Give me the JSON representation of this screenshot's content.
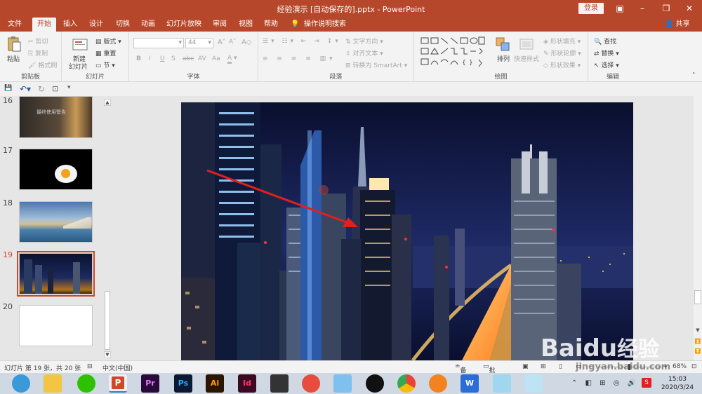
{
  "window": {
    "title": "经验演示 [自动保存的].pptx - PowerPoint",
    "login": "登录"
  },
  "menu": {
    "tabs": [
      "文件",
      "开始",
      "插入",
      "设计",
      "切换",
      "动画",
      "幻灯片放映",
      "审阅",
      "视图",
      "帮助"
    ],
    "active_tab": "开始",
    "tell_me": "操作说明搜索",
    "share": "共享"
  },
  "ribbon": {
    "clipboard": {
      "label": "剪贴板",
      "paste": "粘贴",
      "cut": "剪切",
      "copy": "复制",
      "format_painter": "格式刷"
    },
    "slides": {
      "label": "幻灯片",
      "new_slide": "新建",
      "new_slide_2": "幻灯片",
      "layout": "版式",
      "reset": "重置",
      "section": "节"
    },
    "font": {
      "label": "字体",
      "font_name": "",
      "font_size": "44",
      "bold": "B",
      "italic": "I",
      "underline": "U",
      "strike": "S",
      "shadow": "abc",
      "spacing": "AV",
      "case": "Aa",
      "grow": "A",
      "shrink": "A",
      "clear": "A"
    },
    "paragraph": {
      "label": "段落",
      "text_direction": "文字方向",
      "align_text": "对齐文本",
      "smartart": "转换为 SmartArt"
    },
    "drawing": {
      "label": "绘图",
      "arrange": "排列",
      "quick_styles": "快速样式",
      "shape_fill": "形状填充",
      "shape_outline": "形状轮廓",
      "shape_effects": "形状效果"
    },
    "editing": {
      "label": "编辑",
      "find": "查找",
      "replace": "替换",
      "select": "选择"
    }
  },
  "thumbnails": [
    {
      "number": "16",
      "style": "dog",
      "caption": "最终使用警告"
    },
    {
      "number": "17",
      "style": "egg"
    },
    {
      "number": "18",
      "style": "sea"
    },
    {
      "number": "19",
      "style": "city",
      "selected": true
    },
    {
      "number": "20",
      "style": "blank"
    }
  ],
  "status": {
    "slide_info": "幻灯片 第 19 张，共 20 张",
    "language": "中文(中国)",
    "notes": "备注",
    "comments": "批注",
    "zoom": "68%"
  },
  "taskbar": {
    "time": "15:03",
    "date": "2020/3/24",
    "apps": [
      "browser",
      "file-explorer",
      "wechat",
      "powerpoint",
      "premiere",
      "photoshop",
      "illustrator",
      "indesign",
      "video",
      "app-red",
      "app-bird",
      "qq",
      "chrome",
      "app-orange",
      "wps",
      "tablet1",
      "tablet2"
    ]
  },
  "watermark": {
    "brand_main": "Baidu",
    "brand_cn": "经验",
    "url": "jingyan.baidu.com"
  },
  "colors": {
    "accent": "#b7472a",
    "selection": "#d24726",
    "arrow": "#e02020"
  }
}
